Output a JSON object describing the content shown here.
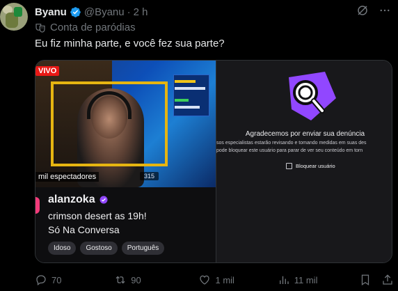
{
  "tweet": {
    "author_name": "Byanu",
    "handle": "@Byanu",
    "separator": "·",
    "time": "2 h",
    "label": "Conta de paródias",
    "text": "Eu fiz minha parte, e você fez sua parte?"
  },
  "stream": {
    "live_badge": "VIVO",
    "viewers": "mil espectadores",
    "overlay_stat": "315",
    "channel": "alanzoka",
    "title": "crimson desert as 19h!",
    "category": "Só Na Conversa",
    "tags": [
      "Idoso",
      "Gostoso",
      "Português"
    ]
  },
  "report": {
    "title": "Agradecemos por enviar sua denúncia",
    "body_line1": "sos especialistas estarão revisando e tomando medidas em suas des",
    "body_line2": "pode bloquear este usuário para parar de ver seu conteúdo em torn",
    "checkbox_label": "Bloquear usuário"
  },
  "actions": {
    "replies": "70",
    "reposts": "90",
    "likes": "1 mil",
    "views": "11 mil"
  },
  "colors": {
    "verified": "#1d9bf0",
    "muted": "#71767b",
    "twitch_purple": "#9147ff",
    "live_red": "#e91916"
  }
}
